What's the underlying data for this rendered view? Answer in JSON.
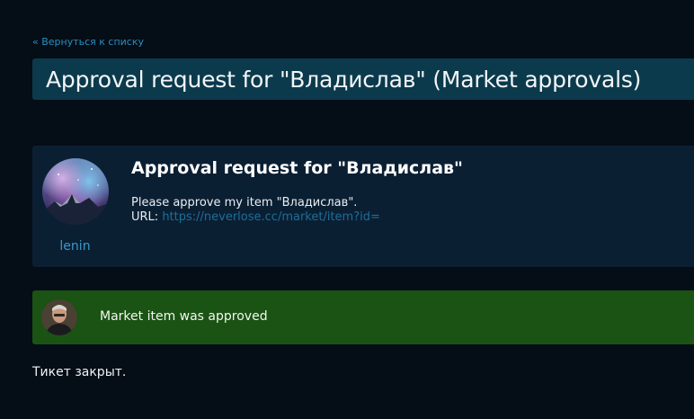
{
  "nav": {
    "back_label": "« Вернуться к списку"
  },
  "page": {
    "title": "Approval request for \"Владислав\" (Market approvals)"
  },
  "ticket": {
    "title": "Approval request for \"Владислав\"",
    "message": "Please approve my item \"Владислав\".",
    "url_label": "URL:",
    "url": "https://neverlose.cc/market/item?id=",
    "author": "lenin"
  },
  "event": {
    "text": "Market item was approved",
    "color": "#1a5313"
  },
  "status": {
    "text": "Тикет закрыт."
  },
  "colors": {
    "background": "#050d16",
    "title_bar": "#0b3a4c",
    "card": "#0b1f33",
    "link": "#2a8fc0"
  }
}
